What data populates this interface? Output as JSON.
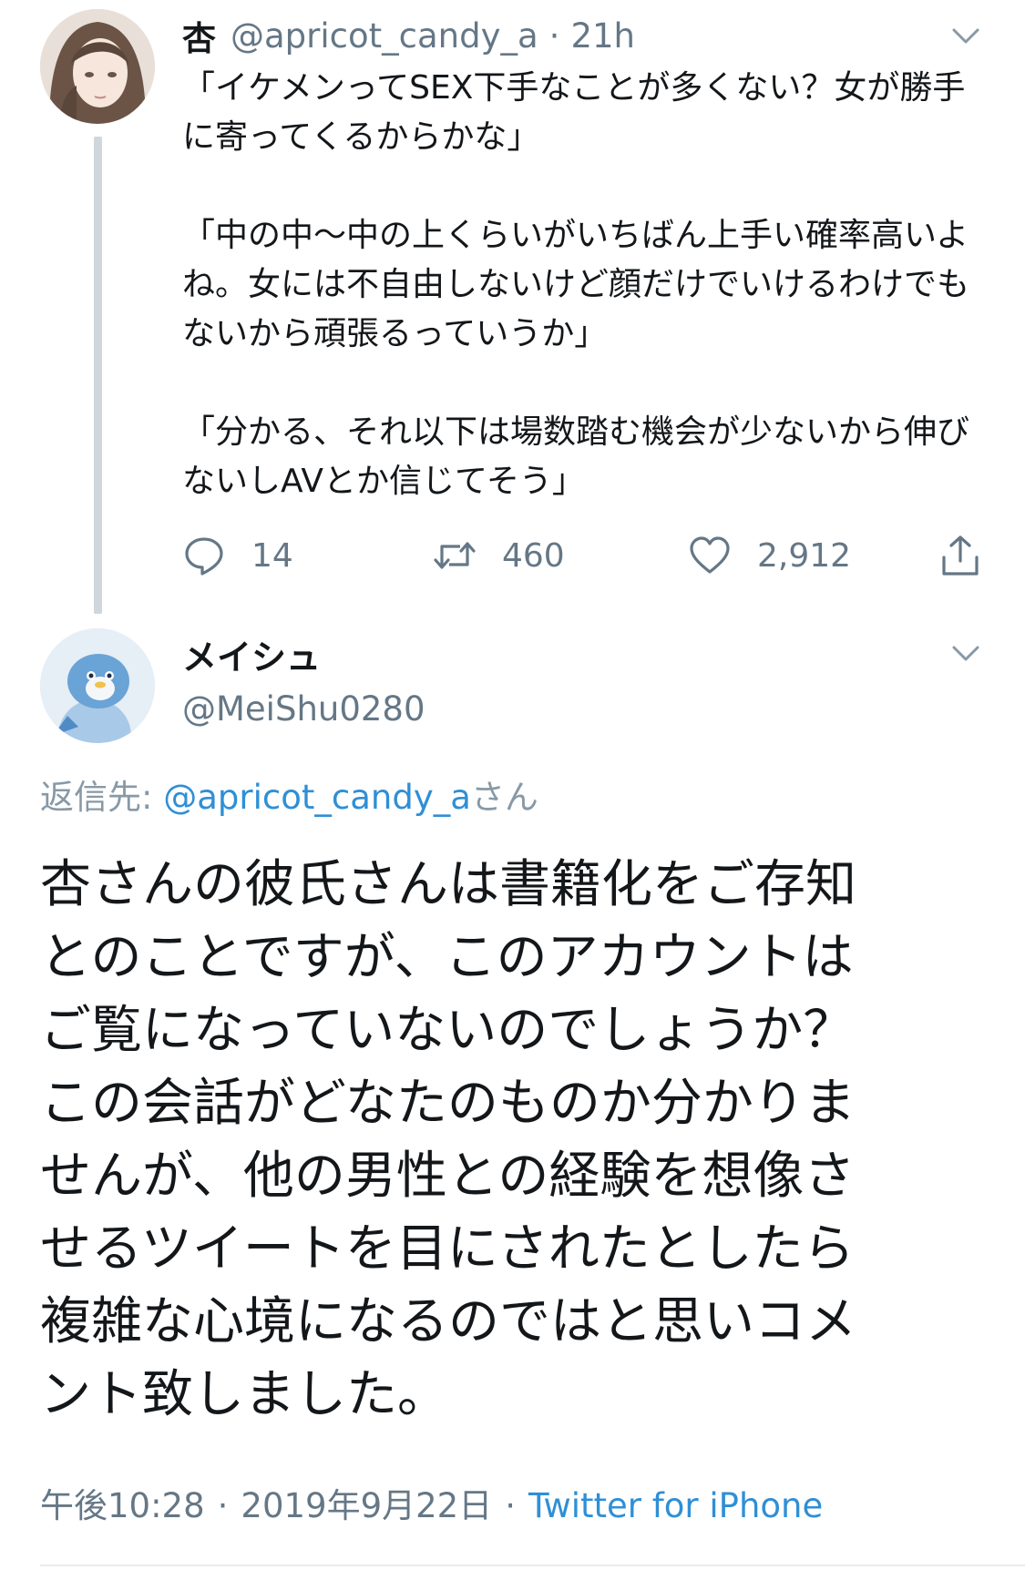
{
  "parent_tweet": {
    "display_name": "杏",
    "handle": "@apricot_candy_a",
    "separator": "·",
    "time": "21h",
    "avatar_icon": "anime-girl-avatar",
    "paragraphs": [
      "「イケメンってSEX下手なことが多くない？女が勝手に寄ってくるからかな」",
      "「中の中〜中の上くらいがいちばん上手い確率高いよね。女には不自由しないけど顔だけでいけるわけでもないから頑張るっていうか」",
      "「分かる、それ以下は場数踏む機会が少ないから伸びないしAVとか信じてそう」"
    ],
    "actions": {
      "reply_count": "14",
      "retweet_count": "460",
      "like_count": "2,912"
    }
  },
  "reply_tweet": {
    "display_name": "メイシュ",
    "handle": "@MeiShu0280",
    "avatar_icon": "blue-penguin-avatar",
    "replying_to_label": "返信先: ",
    "replying_to_handle": "@apricot_candy_a",
    "replying_to_suffix": "さん",
    "body_lines": [
      "杏さんの彼氏さんは書籍化をご存知",
      "とのことですが、このアカウントは",
      "ご覧になっていないのでしょうか？",
      "この会話がどなたのものか分かりま",
      "せんが、他の男性との経験を想像さ",
      "せるツイートを目にされたとしたら",
      "複雑な心境になるのではと思いコメ",
      "ント致しました。"
    ],
    "timestamp": "午後10:28",
    "meta_separator": "·",
    "date": "2019年9月22日",
    "client": "Twitter for iPhone"
  },
  "colors": {
    "text": "#14171a",
    "secondary": "#657786",
    "link": "#2f8fd6",
    "thread_line": "#cfd6dc"
  }
}
